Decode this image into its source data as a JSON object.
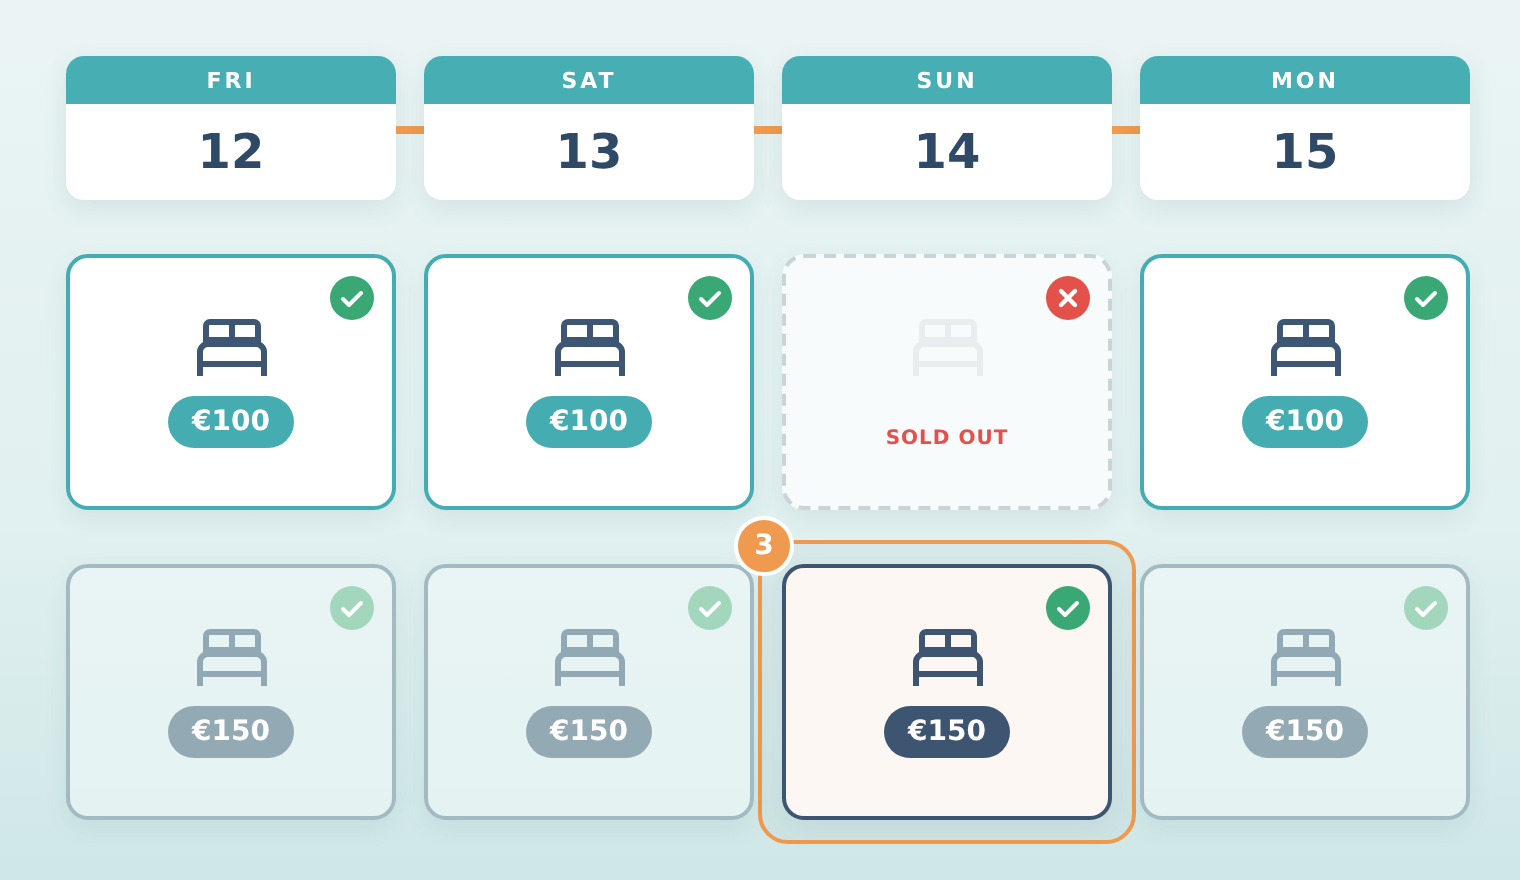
{
  "days": [
    {
      "day": "FRI",
      "date": "12"
    },
    {
      "day": "SAT",
      "date": "13"
    },
    {
      "day": "SUN",
      "date": "14"
    },
    {
      "day": "MON",
      "date": "15"
    }
  ],
  "rows": [
    {
      "cells": [
        {
          "kind": "available",
          "selected": false,
          "price": "€100"
        },
        {
          "kind": "available",
          "selected": false,
          "price": "€100"
        },
        {
          "kind": "sold_out",
          "selected": false,
          "note": "SOLD OUT"
        },
        {
          "kind": "available",
          "selected": false,
          "price": "€100"
        }
      ]
    },
    {
      "cells": [
        {
          "kind": "muted",
          "selected": false,
          "price": "€150"
        },
        {
          "kind": "muted",
          "selected": false,
          "price": "€150"
        },
        {
          "kind": "available",
          "selected": true,
          "price": "€150",
          "badge": "3"
        },
        {
          "kind": "muted",
          "selected": false,
          "price": "€150"
        }
      ]
    }
  ]
}
